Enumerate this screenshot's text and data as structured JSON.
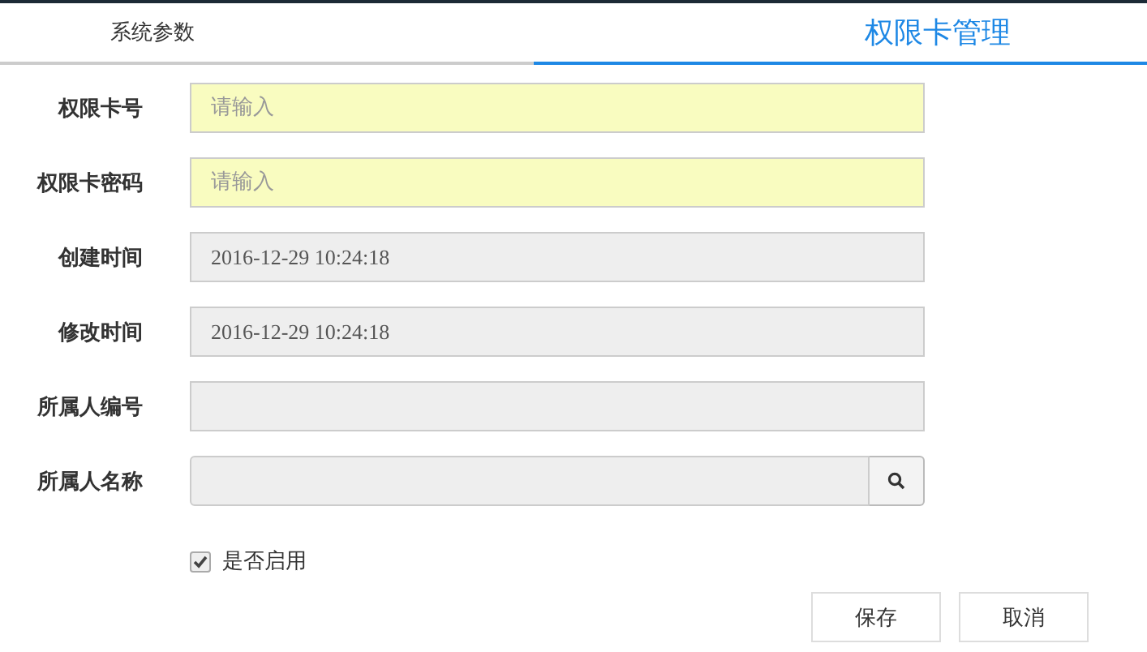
{
  "tabs": [
    {
      "label": "系统参数",
      "selected": false
    },
    {
      "label": "权限卡管理",
      "selected": true
    }
  ],
  "fields": [
    {
      "kind": "input",
      "label": "权限卡号",
      "placeholder": "请输入"
    },
    {
      "kind": "input",
      "label": "权限卡密码",
      "placeholder": "请输入"
    },
    {
      "kind": "readonly",
      "label": "创建时间",
      "value": "2016-12-29 10:24:18"
    },
    {
      "kind": "readonly",
      "label": "修改时间",
      "value": "2016-12-29 10:24:18"
    },
    {
      "kind": "readonly",
      "label": "所属人编号"
    },
    {
      "kind": "search",
      "label": "所属人名称"
    }
  ],
  "enabled": {
    "label": "是否启用",
    "checked": true
  },
  "buttons": [
    "保存",
    "取消"
  ]
}
